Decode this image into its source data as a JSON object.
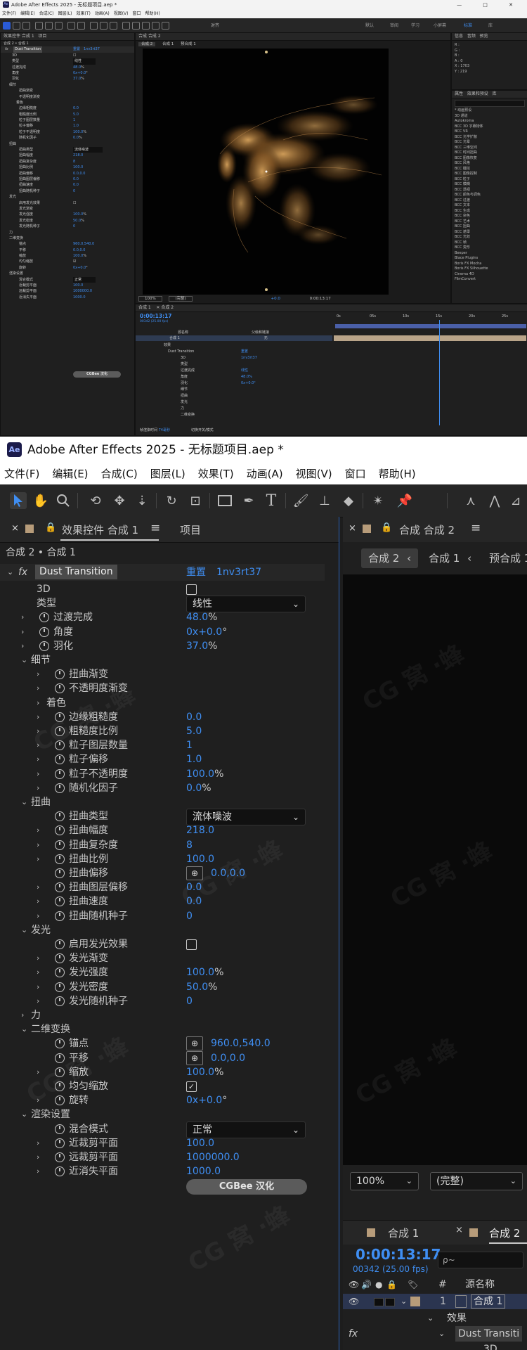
{
  "window": {
    "title": "Adobe After Effects 2025 - 无标题项目.aep *",
    "app_badge": "Ae"
  },
  "menu": [
    "文件(F)",
    "编辑(E)",
    "合成(C)",
    "图层(L)",
    "效果(T)",
    "动画(A)",
    "视图(V)",
    "窗口",
    "帮助(H)"
  ],
  "overview": {
    "title": "Adobe After Effects 2025 - 无标题项目.aep *",
    "window_buttons": "—  □  ✕",
    "toolbar_checkbox": "对齐",
    "workspaces": [
      "默认",
      "审阅",
      "学习",
      "小屏幕",
      "标准",
      "库"
    ],
    "info_panel_tabs": [
      "信息",
      "音频",
      "预览"
    ],
    "info_values": [
      "R :",
      "G :",
      "B :",
      "A : 0",
      "X : 1703",
      "Y : 219"
    ],
    "effects_tabs": [
      "属性",
      "效果和预设",
      "库"
    ],
    "effects_list": [
      "* 动画预设",
      "3D 通道",
      "Autokroma",
      "BCC 3D 字幕物体",
      "BCC VR",
      "BCC 光学扩散",
      "BCC 光晕",
      "BCC 三维空间",
      "BCC 时间扭曲",
      "BCC 图像恢复",
      "BCC 风格",
      "BCC 键控",
      "BCC 图像控制",
      "BCC 粒子",
      "BCC 模糊",
      "BCC 透视",
      "BCC 颜色与调色",
      "BCC 过渡",
      "BCC 文本",
      "BCC 生成",
      "BCC 杂色",
      "BCC 艺术",
      "BCC 扭曲",
      "BCC 遮罩",
      "BCC 光效",
      "BCC 帧",
      "BCC 变形",
      "Beeper",
      "Blace Plugins",
      "Boris FX Mocha",
      "Boris FX Silhouette",
      "Cinema 4D",
      "FilmConvert"
    ],
    "comp_tab": "合成 合成 2",
    "comp_nav": [
      "合成 2",
      "合成 1",
      "预合成 1"
    ],
    "viewer_zoom": "100%",
    "viewer_quality": "(完整)",
    "viewer_time": "0:00:13:17",
    "viewer_offset": "+0.0",
    "timeline_tabs": [
      "合成 1",
      "合成 2"
    ],
    "timeline_time": "0:00:13:17",
    "timeline_fps": "00342 (25.00 fps)",
    "ruler": [
      "0s",
      "05s",
      "10s",
      "15s",
      "20s",
      "25s"
    ],
    "layer_header": [
      "源名称",
      "父级和链接"
    ],
    "layer_name": "合成 1",
    "layer_parent": "无",
    "tl_props": [
      "效果",
      "Dust Transition",
      "3D",
      "类型",
      "过渡完成",
      "角度",
      "羽化",
      "细节",
      "扭曲",
      "发光",
      "力",
      "二维变换"
    ],
    "tl_prop_values": [
      "重置",
      "1nv3rt37",
      "",
      "线性",
      "48.0%",
      "0x+0.0°",
      "37.0%"
    ],
    "tl_footer": [
      "帧渲染时间",
      "74毫秒",
      "切换开关/模式"
    ]
  },
  "fx_panel": {
    "tab_title": "效果控件 合成 1",
    "other_tab": "项目",
    "breadcrumb": "合成 2 • 合成 1",
    "effect_badge": "fx",
    "effect_name": "Dust Transition",
    "reset_label": "重置",
    "effect_id": "1nv3rt37",
    "rows": [
      {
        "label": "3D",
        "kind": "checkbox",
        "checked": false,
        "indent": 1,
        "twirl": false,
        "stopwatch": false
      },
      {
        "label": "类型",
        "kind": "dropdown",
        "value": "线性",
        "indent": 1,
        "twirl": false,
        "stopwatch": false
      },
      {
        "label": "过渡完成",
        "kind": "value",
        "value": "48.0",
        "unit": "%",
        "indent": 1,
        "twirl": "closed",
        "stopwatch": true
      },
      {
        "label": "角度",
        "kind": "value",
        "value": "0x+0.0",
        "unit": "°",
        "indent": 1,
        "twirl": "closed",
        "stopwatch": true
      },
      {
        "label": "羽化",
        "kind": "value",
        "value": "37.0",
        "unit": "%",
        "indent": 1,
        "twirl": "closed",
        "stopwatch": true
      },
      {
        "label": "细节",
        "kind": "group",
        "indent": 1,
        "twirl": "open"
      },
      {
        "label": "扭曲渐变",
        "kind": "plain",
        "indent": 2,
        "twirl": "closed",
        "stopwatch": true
      },
      {
        "label": "不透明度渐变",
        "kind": "plain",
        "indent": 2,
        "twirl": "closed",
        "stopwatch": true
      },
      {
        "label": "着色",
        "kind": "group",
        "indent": 2,
        "twirl": "closed"
      },
      {
        "label": "边缘粗糙度",
        "kind": "value",
        "value": "0.0",
        "unit": "",
        "indent": 2,
        "twirl": "closed",
        "stopwatch": true
      },
      {
        "label": "粗糙度比例",
        "kind": "value",
        "value": "5.0",
        "unit": "",
        "indent": 2,
        "twirl": "closed",
        "stopwatch": true
      },
      {
        "label": "粒子图层数量",
        "kind": "value",
        "value": "1",
        "unit": "",
        "indent": 2,
        "twirl": "closed",
        "stopwatch": true
      },
      {
        "label": "粒子偏移",
        "kind": "value",
        "value": "1.0",
        "unit": "",
        "indent": 2,
        "twirl": "closed",
        "stopwatch": true
      },
      {
        "label": "粒子不透明度",
        "kind": "value",
        "value": "100.0",
        "unit": "%",
        "indent": 2,
        "twirl": "closed",
        "stopwatch": true
      },
      {
        "label": "随机化因子",
        "kind": "value",
        "value": "0.0",
        "unit": "%",
        "indent": 2,
        "twirl": "closed",
        "stopwatch": true
      },
      {
        "label": "扭曲",
        "kind": "group",
        "indent": 1,
        "twirl": "open"
      },
      {
        "label": "扭曲类型",
        "kind": "dropdown",
        "value": "流体噪波",
        "indent": 2,
        "twirl": false,
        "stopwatch": true
      },
      {
        "label": "扭曲幅度",
        "kind": "value",
        "value": "218.0",
        "unit": "",
        "indent": 2,
        "twirl": "closed",
        "stopwatch": true
      },
      {
        "label": "扭曲复杂度",
        "kind": "value",
        "value": "8",
        "unit": "",
        "indent": 2,
        "twirl": "closed",
        "stopwatch": true
      },
      {
        "label": "扭曲比例",
        "kind": "value",
        "value": "100.0",
        "unit": "",
        "indent": 2,
        "twirl": "closed",
        "stopwatch": true
      },
      {
        "label": "扭曲偏移",
        "kind": "point",
        "value": "0.0,0.0",
        "indent": 2,
        "twirl": false,
        "stopwatch": true
      },
      {
        "label": "扭曲图层偏移",
        "kind": "value",
        "value": "0.0",
        "unit": "",
        "indent": 2,
        "twirl": "closed",
        "stopwatch": true
      },
      {
        "label": "扭曲速度",
        "kind": "value",
        "value": "0.0",
        "unit": "",
        "indent": 2,
        "twirl": "closed",
        "stopwatch": true
      },
      {
        "label": "扭曲随机种子",
        "kind": "value",
        "value": "0",
        "unit": "",
        "indent": 2,
        "twirl": "closed",
        "stopwatch": true
      },
      {
        "label": "发光",
        "kind": "group",
        "indent": 1,
        "twirl": "open"
      },
      {
        "label": "启用发光效果",
        "kind": "checkbox",
        "checked": false,
        "indent": 2,
        "twirl": false,
        "stopwatch": true
      },
      {
        "label": "发光渐变",
        "kind": "plain",
        "indent": 2,
        "twirl": "closed",
        "stopwatch": true
      },
      {
        "label": "发光强度",
        "kind": "value",
        "value": "100.0",
        "unit": "%",
        "indent": 2,
        "twirl": "closed",
        "stopwatch": true
      },
      {
        "label": "发光密度",
        "kind": "value",
        "value": "50.0",
        "unit": "%",
        "indent": 2,
        "twirl": "closed",
        "stopwatch": true
      },
      {
        "label": "发光随机种子",
        "kind": "value",
        "value": "0",
        "unit": "",
        "indent": 2,
        "twirl": "closed",
        "stopwatch": true
      },
      {
        "label": "力",
        "kind": "group",
        "indent": 1,
        "twirl": "closed"
      },
      {
        "label": "二维变换",
        "kind": "group",
        "indent": 1,
        "twirl": "open"
      },
      {
        "label": "锚点",
        "kind": "point",
        "value": "960.0,540.0",
        "indent": 2,
        "twirl": false,
        "stopwatch": true
      },
      {
        "label": "平移",
        "kind": "point",
        "value": "0.0,0.0",
        "indent": 2,
        "twirl": false,
        "stopwatch": true
      },
      {
        "label": "缩放",
        "kind": "value",
        "value": "100.0",
        "unit": "%",
        "indent": 2,
        "twirl": "closed",
        "stopwatch": true
      },
      {
        "label": "均匀缩放",
        "kind": "checkbox",
        "checked": true,
        "indent": 2,
        "twirl": false,
        "stopwatch": true
      },
      {
        "label": "旋转",
        "kind": "value",
        "value": "0x+0.0",
        "unit": "°",
        "indent": 2,
        "twirl": "closed",
        "stopwatch": true
      },
      {
        "label": "渲染设置",
        "kind": "group",
        "indent": 1,
        "twirl": "open"
      },
      {
        "label": "混合模式",
        "kind": "dropdown",
        "value": "正常",
        "indent": 2,
        "twirl": false,
        "stopwatch": true
      },
      {
        "label": "近裁剪平面",
        "kind": "value",
        "value": "100.0",
        "unit": "",
        "indent": 2,
        "twirl": "closed",
        "stopwatch": true
      },
      {
        "label": "远裁剪平面",
        "kind": "value",
        "value": "1000000.0",
        "unit": "",
        "indent": 2,
        "twirl": "closed",
        "stopwatch": true
      },
      {
        "label": "近消失平面",
        "kind": "value",
        "value": "1000.0",
        "unit": "",
        "indent": 2,
        "twirl": "closed",
        "stopwatch": true
      }
    ],
    "cgbee_button": "CGBee 汉化"
  },
  "comp_panel": {
    "tab_title": "合成 合成 2",
    "nav": [
      "合成 2",
      "合成 1",
      "预合成 1"
    ],
    "zoom": "100%",
    "quality": "(完整)"
  },
  "timeline": {
    "tabs": [
      "合成 1",
      "合成 2"
    ],
    "time": "0:00:13:17",
    "fps": "00342 (25.00 fps)",
    "search_placeholder": "ρ~",
    "header_hash": "#",
    "header_source": "源名称",
    "layer_index": "1",
    "layer_name": "合成 1",
    "effects_label": "效果",
    "effect_name": "Dust Transiti",
    "sub_props": [
      "3D",
      "类型",
      "过渡完成",
      "角度"
    ]
  },
  "watermark": "CG 窝 ·蜂"
}
